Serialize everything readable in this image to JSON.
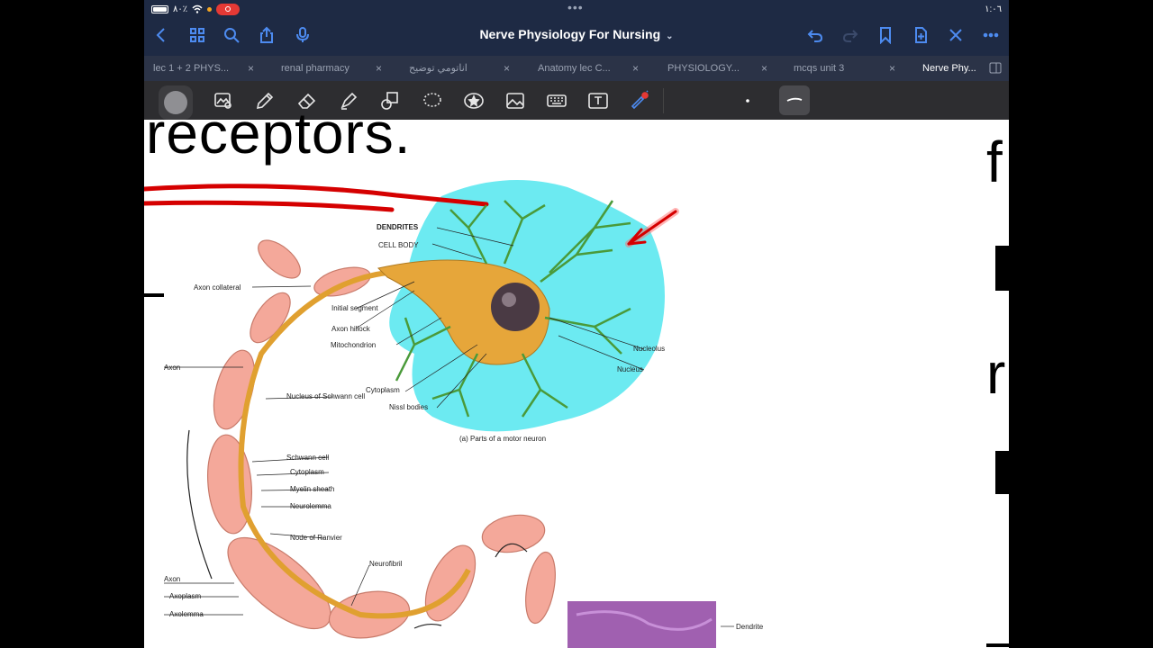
{
  "status": {
    "battery_pct": "٨٠٪",
    "time": "١:٠٦"
  },
  "nav": {
    "title": "Nerve Physiology For Nursing",
    "icons": [
      "back-icon",
      "grid-icon",
      "search-icon",
      "share-icon",
      "mic-icon",
      "undo-icon",
      "redo-icon",
      "bookmark-icon",
      "add-page-icon",
      "close-icon",
      "more-icon"
    ]
  },
  "tabs": [
    {
      "label": "lec 1 + 2 PHYS..."
    },
    {
      "label": "renal pharmacy"
    },
    {
      "label": "اناتومي توضيح"
    },
    {
      "label": "Anatomy lec C..."
    },
    {
      "label": "PHYSIOLOGY..."
    },
    {
      "label": "mcqs unit 3"
    },
    {
      "label": "Nerve Phy..."
    }
  ],
  "toolbar": {
    "tools": [
      "pen-color",
      "lasso-image",
      "pen",
      "eraser",
      "highlighter",
      "shapes",
      "lasso",
      "sticker",
      "image",
      "keyboard",
      "text",
      "laser-pointer"
    ],
    "pen_color": "#8f8f93"
  },
  "content": {
    "heading": "receptors.",
    "side_letters": [
      "f",
      "r"
    ],
    "figure": {
      "labels": {
        "dendrites": "DENDRITES",
        "cell_body": "CELL BODY",
        "axon_collateral": "Axon collateral",
        "initial_segment": "Initial segment",
        "axon_hillock": "Axon hillock",
        "mitochondrion": "Mitochondrion",
        "axon": "Axon",
        "nucleus_schwann": "Nucleus of Schwann cell",
        "schwann_cell": "Schwann cell",
        "cytoplasm": "Cytoplasm",
        "myelin_sheath": "Myelin sheath",
        "neurolemma": "Neurolemma",
        "node_ranvier": "Node of Ranvier",
        "neurofibril": "Neurofibril",
        "axon_terminal": "Axon",
        "axoplasm": "Axoplasm",
        "axolemma": "Axolemma",
        "nucleolus": "Nucleolus",
        "nucleus": "Nucleus",
        "cytoplasm2": "Cytoplasm",
        "nissl_bodies": "Nissl bodies",
        "caption": "(a) Parts of a motor neuron",
        "dendrite2": "Dendrite"
      }
    }
  },
  "colors": {
    "nav_bg": "#1e2a44",
    "accent": "#4d8bf0",
    "annotation_red": "#d50000",
    "highlight_cyan": "#5ce8f0"
  }
}
